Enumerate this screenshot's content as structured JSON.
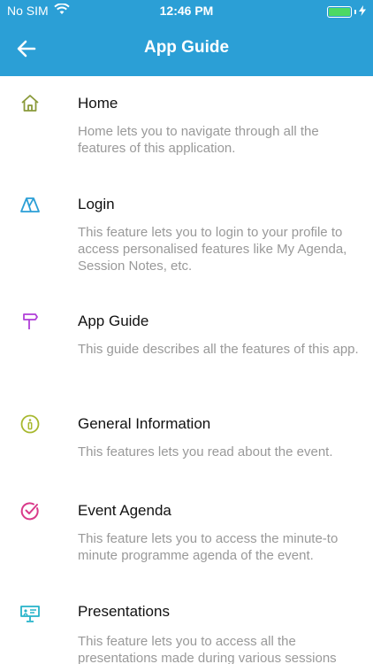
{
  "status_bar": {
    "carrier": "No SIM",
    "time": "12:46 PM",
    "battery_color": "#4cd964",
    "icons": [
      "wifi-icon",
      "battery-icon",
      "charging-bolt-icon"
    ]
  },
  "header": {
    "title": "App Guide",
    "back_icon": "back-arrow-icon",
    "background": "#2b9fd6"
  },
  "items": [
    {
      "title": "Home",
      "icon": "home-icon",
      "icon_color": "#8a9a3a",
      "description": "Home lets you to navigate through all the features of this application."
    },
    {
      "title": "Login",
      "icon": "login-icon",
      "icon_color": "#2b9fd6",
      "description": "This feature lets you to login to your profile to access personalised features like My Agenda, Session Notes, etc."
    },
    {
      "title": "App Guide",
      "icon": "signpost-icon",
      "icon_color": "#b03fd8",
      "description": "This guide describes all the features of this app."
    },
    {
      "title": "General Information",
      "icon": "info-icon",
      "icon_color": "#a7b82e",
      "description": "This features lets you read about the event."
    },
    {
      "title": "Event Agenda",
      "icon": "agenda-check-icon",
      "icon_color": "#d93a8a",
      "description": "This feature lets you to access the minute-to minute programme agenda of the event."
    },
    {
      "title": "Presentations",
      "icon": "presentation-icon",
      "icon_color": "#26b3c9",
      "description": "This feature lets you to access all the presentations made during various sessions"
    }
  ]
}
